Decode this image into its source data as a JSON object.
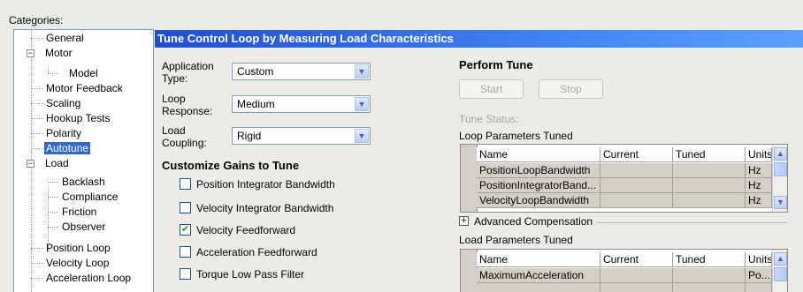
{
  "categories_label": "Categories:",
  "tree": {
    "general": "General",
    "motor": "Motor",
    "model": "Model",
    "motor_feedback": "Motor Feedback",
    "scaling": "Scaling",
    "hookup_tests": "Hookup Tests",
    "polarity": "Polarity",
    "autotune": "Autotune",
    "load": "Load",
    "backlash": "Backlash",
    "compliance": "Compliance",
    "friction": "Friction",
    "observer": "Observer",
    "position_loop": "Position Loop",
    "velocity_loop": "Velocity Loop",
    "acceleration_loop": "Acceleration Loop"
  },
  "header": "Tune Control Loop by Measuring Load Characteristics",
  "fields": {
    "application_type": {
      "label": "Application Type:",
      "value": "Custom"
    },
    "loop_response": {
      "label": "Loop Response:",
      "value": "Medium"
    },
    "load_coupling": {
      "label": "Load Coupling:",
      "value": "Rigid"
    }
  },
  "customize": {
    "title": "Customize Gains to Tune",
    "options": [
      {
        "label": "Position Integrator Bandwidth",
        "checked": false
      },
      {
        "label": "Velocity Integrator Bandwidth",
        "checked": false
      },
      {
        "label": "Velocity Feedforward",
        "checked": true
      },
      {
        "label": "Acceleration Feedforward",
        "checked": false
      },
      {
        "label": "Torque Low Pass Filter",
        "checked": false
      }
    ]
  },
  "perform": {
    "title": "Perform Tune",
    "start": "Start",
    "stop": "Stop",
    "tune_status": "Tune Status:"
  },
  "loop_params": {
    "title": "Loop Parameters Tuned",
    "columns": [
      "Name",
      "Current",
      "Tuned",
      "Units"
    ],
    "rows": [
      [
        "PositionLoopBandwidth",
        "",
        "",
        "Hz"
      ],
      [
        "PositionIntegratorBand...",
        "",
        "",
        "Hz"
      ],
      [
        "VelocityLoopBandwidth",
        "",
        "",
        "Hz"
      ]
    ]
  },
  "advanced": {
    "icon": "plus-box-icon",
    "label": "Advanced Compensation"
  },
  "load_params": {
    "title": "Load Parameters Tuned",
    "columns": [
      "Name",
      "Current",
      "Tuned",
      "Units"
    ],
    "rows": [
      [
        "MaximumAcceleration",
        "",
        "",
        "Po..."
      ]
    ]
  },
  "colors": {
    "header_start": "#1e4fd0",
    "header_end": "#5aa0ff",
    "selection": "#316ac5",
    "check": "#21a121"
  }
}
